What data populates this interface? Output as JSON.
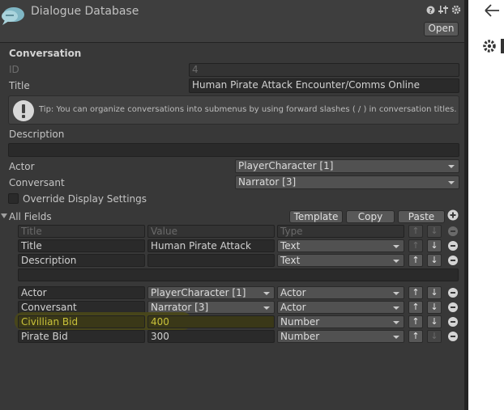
{
  "window": {
    "title": "Dialogue Database",
    "open_button": "Open"
  },
  "conversation": {
    "section_label": "Conversation",
    "id_label": "ID",
    "id_value": "4",
    "title_label": "Title",
    "title_value": "Human Pirate Attack Encounter/Comms Online",
    "tip": "Tip: You can organize conversations into submenus by using forward slashes ( / ) in conversation titles.",
    "description_label": "Description",
    "description_value": "",
    "actor_label": "Actor",
    "actor_value": "PlayerCharacter [1]",
    "conversant_label": "Conversant",
    "conversant_value": "Narrator [3]",
    "override_label": "Override Display Settings"
  },
  "all_fields": {
    "label": "All Fields",
    "template_button": "Template",
    "copy_button": "Copy",
    "paste_button": "Paste",
    "header": {
      "title": "Title",
      "value": "Value",
      "type": "Type"
    },
    "rows": [
      {
        "title": "Title",
        "value": "Human Pirate Attack",
        "type": "Text"
      },
      {
        "title": "Description",
        "value": "",
        "type": "Text"
      }
    ],
    "rows2": [
      {
        "title": "Actor",
        "value": "PlayerCharacter [1]",
        "type": "Actor"
      },
      {
        "title": "Conversant",
        "value": "Narrator [3]",
        "type": "Actor"
      },
      {
        "title": "Civillian Bid",
        "value": "400",
        "type": "Number"
      },
      {
        "title": "Pirate Bid",
        "value": "300",
        "type": "Number"
      }
    ]
  },
  "colors": {
    "highlight": "#4d4a1c",
    "highlight_text": "#c9c23a"
  },
  "icons": [
    "dialogue-logo-icon",
    "help-icon",
    "settings-sliders-icon",
    "gear-icon",
    "info-icon",
    "back-arrow-icon"
  ]
}
